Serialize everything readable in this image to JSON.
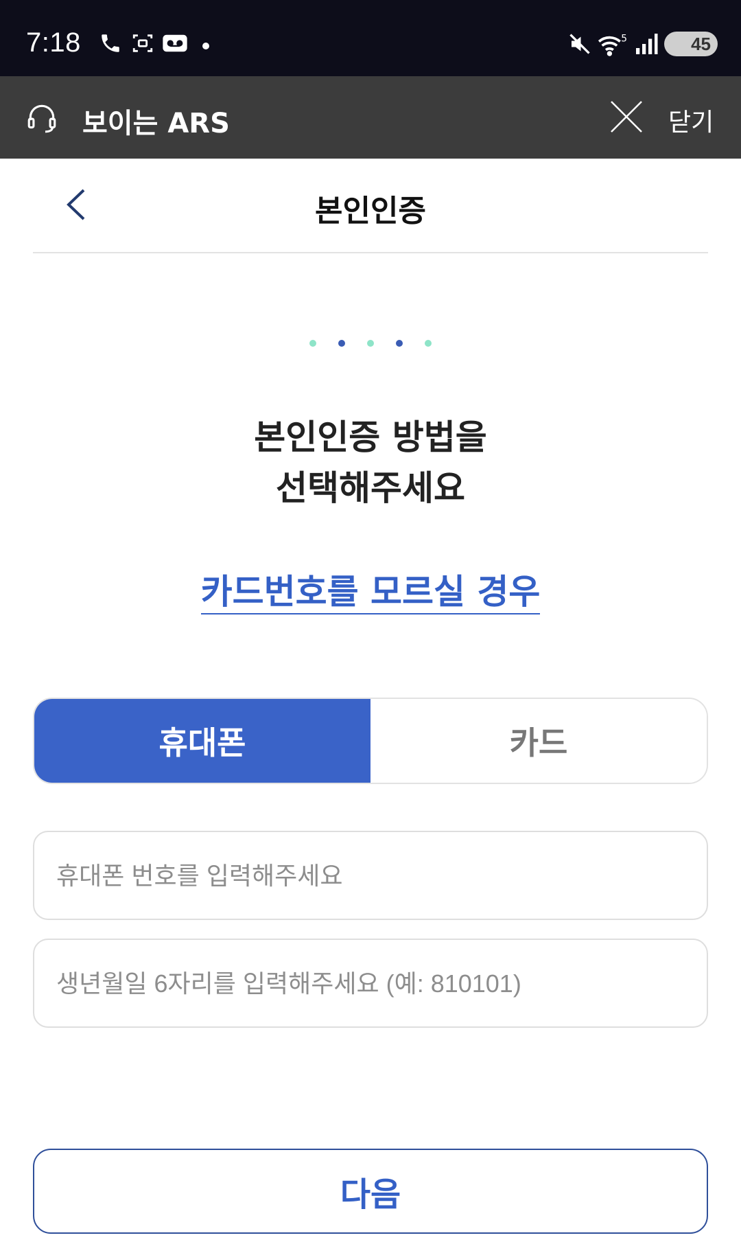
{
  "status_bar": {
    "time": "7:18",
    "battery": "45",
    "icons": [
      "phone-icon",
      "screenshot-icon",
      "voicemail-icon",
      "dot-icon",
      "mute-icon",
      "wifi-5g-icon",
      "signal-icon",
      "battery-icon"
    ]
  },
  "app_header": {
    "icon": "headset-icon",
    "title": "보이는 ARS",
    "close_icon": "close-icon",
    "close_label": "닫기"
  },
  "nav": {
    "back_icon": "chevron-left-icon",
    "title": "본인인증"
  },
  "progress_dots": {
    "count": 5,
    "colors": [
      "#8ee4c8",
      "#3a5cb4",
      "#8ee4c8",
      "#3a5cb4",
      "#8ee4c8"
    ]
  },
  "heading": {
    "line1": "본인인증 방법을",
    "line2": "선택해주세요"
  },
  "help_link": "카드번호를 모르실 경우",
  "tabs": [
    {
      "label": "휴대폰",
      "active": true
    },
    {
      "label": "카드",
      "active": false
    }
  ],
  "form": {
    "phone_placeholder": "휴대폰 번호를 입력해주세요",
    "birth_placeholder": "생년월일 6자리를 입력해주세요 (예: 810101)"
  },
  "next_button": "다음",
  "colors": {
    "primary": "#3a63c8",
    "header_bg": "#3c3c3c",
    "status_bg": "#0d0d1a",
    "link": "#3460c6"
  }
}
